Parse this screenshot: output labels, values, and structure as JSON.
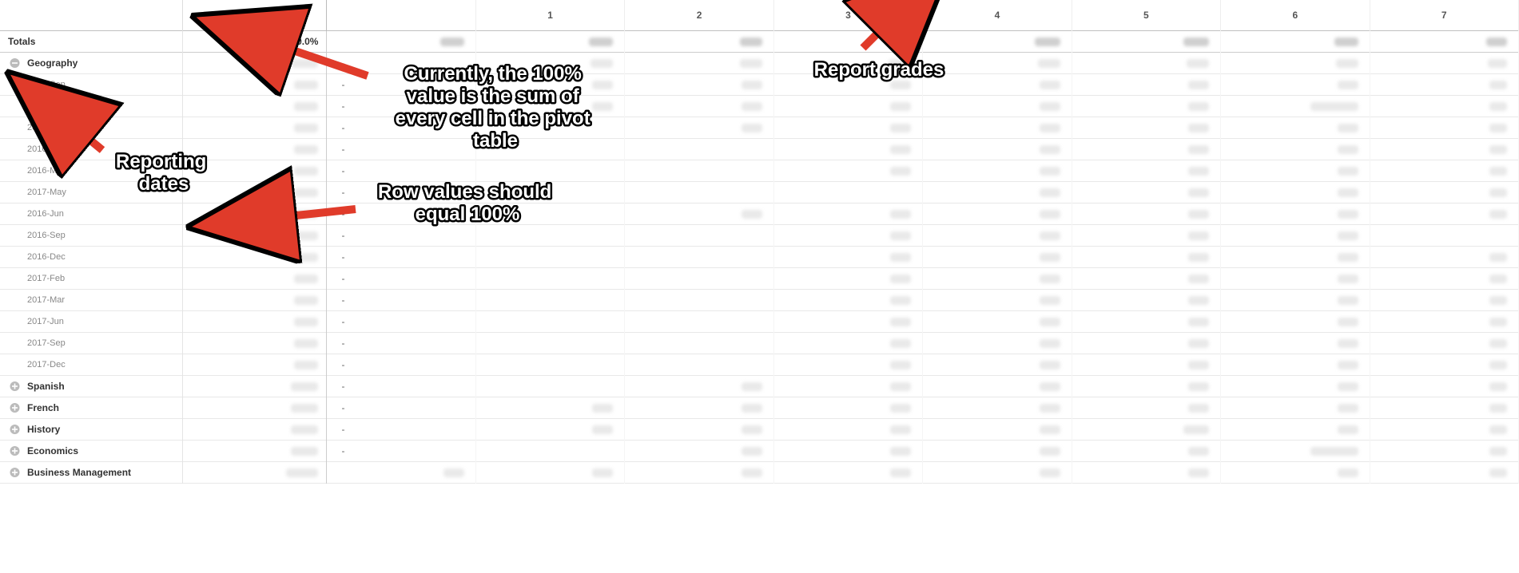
{
  "header": {
    "blank": "",
    "totals_label": "Totals",
    "grade_columns": [
      "",
      "1",
      "2",
      "3",
      "4",
      "5",
      "6",
      "7"
    ]
  },
  "totals_row": {
    "label": "Totals",
    "value": "100.0%"
  },
  "subjects": [
    {
      "name": "Geography",
      "expanded": true,
      "dates": [
        "2015-Sep",
        "2015-Dec",
        "2016-Feb",
        "2016-Mar",
        "2016-May",
        "2017-May",
        "2016-Jun",
        "2016-Sep",
        "2016-Dec",
        "2017-Feb",
        "2017-Mar",
        "2017-Jun",
        "2017-Sep",
        "2017-Dec"
      ]
    },
    {
      "name": "Spanish",
      "expanded": false
    },
    {
      "name": "French",
      "expanded": false
    },
    {
      "name": "History",
      "expanded": false
    },
    {
      "name": "Economics",
      "expanded": false
    },
    {
      "name": "Business Management",
      "expanded": false
    }
  ],
  "dash": "-",
  "annotations": {
    "a1": "Currently, the 100% value is the sum of every cell in the pivot table",
    "a2": "Row values should equal 100%",
    "a3": "Reporting dates",
    "a4": "Report grades"
  }
}
